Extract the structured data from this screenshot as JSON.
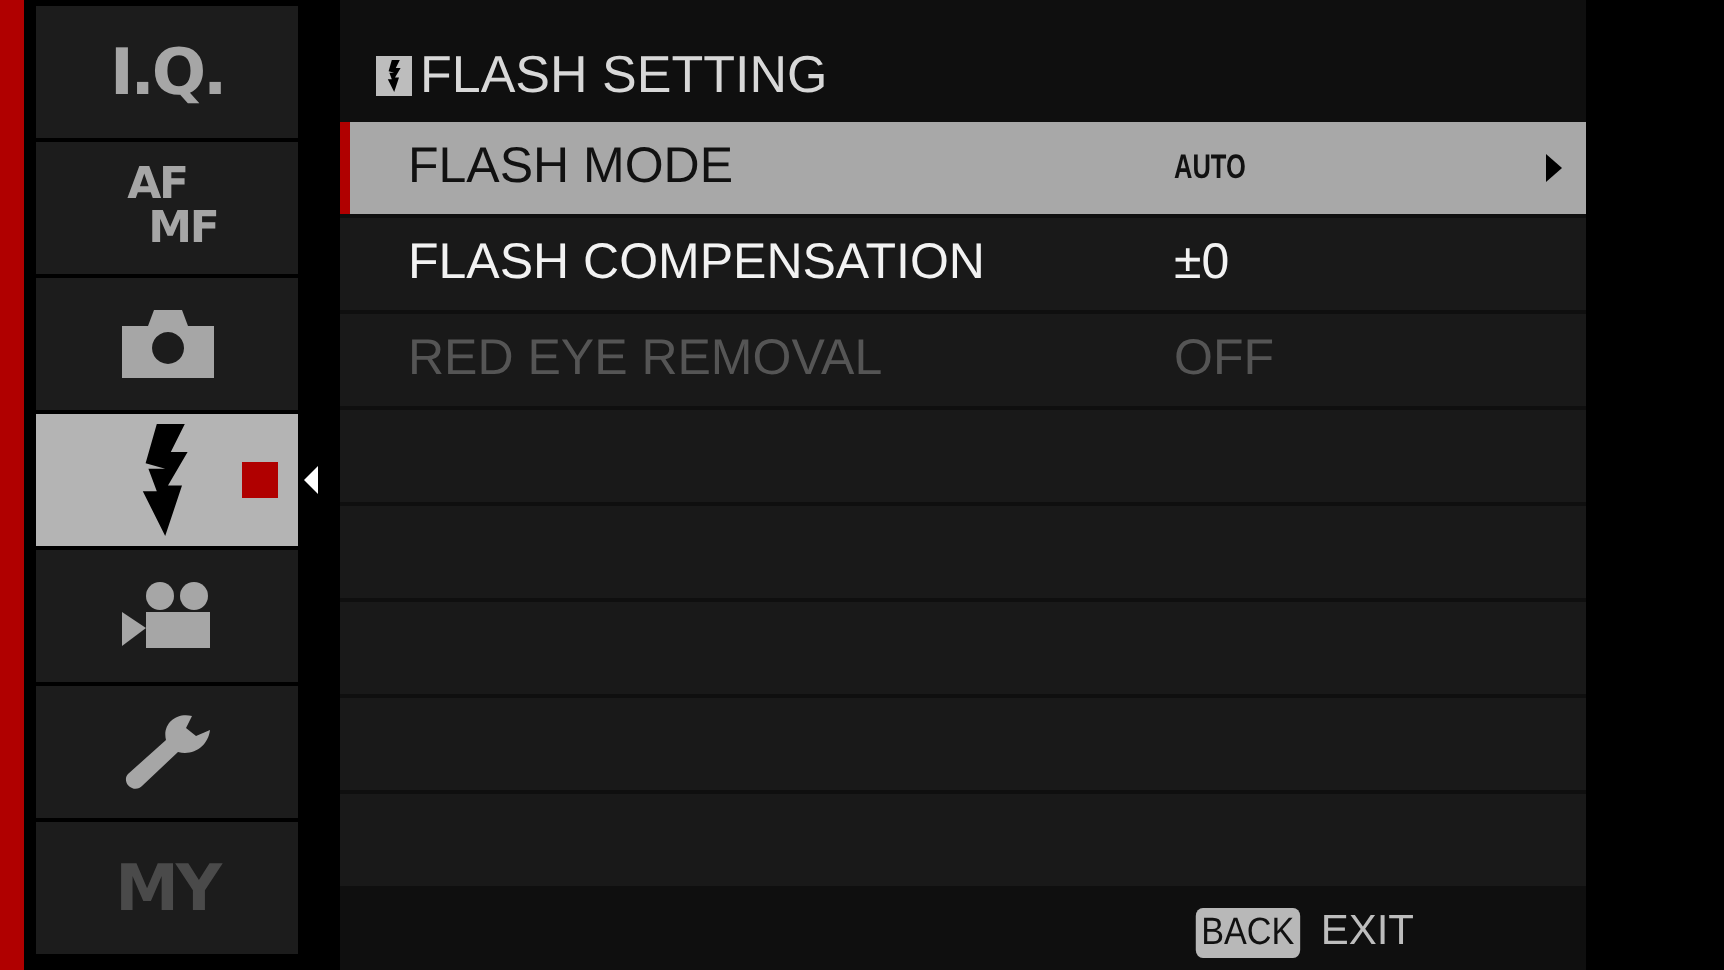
{
  "sidebar": {
    "tabs": [
      {
        "kind": "text",
        "lines": [
          "I.Q."
        ],
        "selected": false,
        "disabled": false
      },
      {
        "kind": "text",
        "lines": [
          "AF",
          "MF"
        ],
        "selected": false,
        "disabled": false
      },
      {
        "kind": "camera",
        "selected": false,
        "disabled": false
      },
      {
        "kind": "flash",
        "selected": true,
        "disabled": false
      },
      {
        "kind": "movie",
        "selected": false,
        "disabled": false
      },
      {
        "kind": "wrench",
        "selected": false,
        "disabled": false
      },
      {
        "kind": "text",
        "lines": [
          "MY"
        ],
        "selected": false,
        "disabled": true
      }
    ]
  },
  "menu": {
    "title": "FLASH SETTING",
    "rows": [
      {
        "label": "FLASH MODE",
        "value": "AUTO",
        "selected": true,
        "disabled": false
      },
      {
        "label": "FLASH COMPENSATION",
        "value": "±0",
        "selected": false,
        "disabled": false
      },
      {
        "label": "RED EYE REMOVAL",
        "value": "OFF",
        "selected": false,
        "disabled": true
      }
    ]
  },
  "footer": {
    "key": "BACK",
    "action": "EXIT"
  }
}
